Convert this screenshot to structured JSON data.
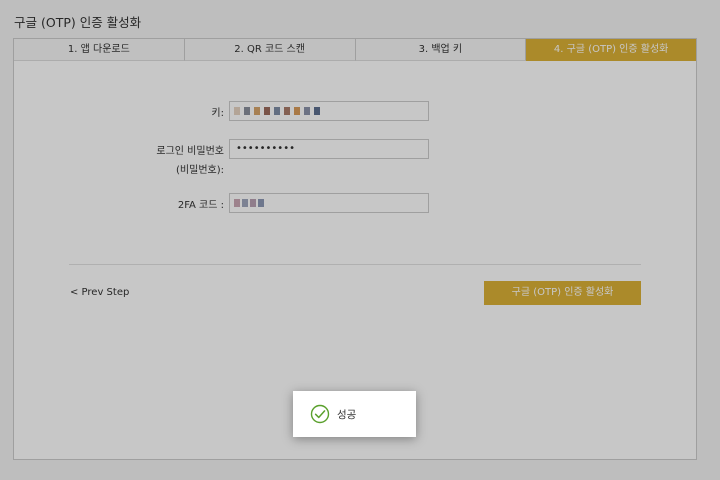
{
  "page": {
    "title": "구글 (OTP) 인증 활성화"
  },
  "tabs": [
    {
      "label": "1. 앱 다운로드",
      "active": false
    },
    {
      "label": "2. QR 코드 스캔",
      "active": false
    },
    {
      "label": "3. 백업 키",
      "active": false
    },
    {
      "label": "4. 구글 (OTP) 인증 활성화",
      "active": true
    }
  ],
  "form": {
    "key_label": "키:",
    "key_value": "",
    "password_label_line1": "로그인 비밀번호",
    "password_label_line2": "(비밀번호):",
    "password_value": "••••••••••",
    "code_label": "2FA 코드 :",
    "code_value": ""
  },
  "nav": {
    "prev_label": "< Prev Step",
    "submit_label": "구글 (OTP) 인증 활성화"
  },
  "toast": {
    "message": "성공",
    "icon": "check-circle-icon",
    "icon_color": "#5aa02c"
  },
  "colors": {
    "accent": "#dcb137",
    "overlay": "rgba(0,0,0,0.22)"
  }
}
